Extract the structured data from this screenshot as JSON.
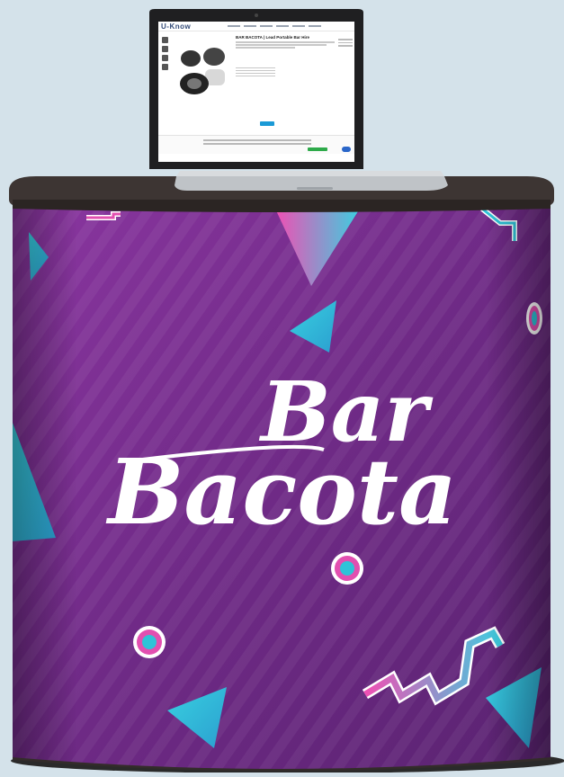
{
  "screen": {
    "brand": "U-Know",
    "product_title": "BAR BACOTA | Lead Portable Bar Hire"
  },
  "booth": {
    "headline_line1": "Bar",
    "headline_line2": "Bacota"
  },
  "colors": {
    "background": "#d4e2ea",
    "booth_purple": "#7b2f8e",
    "accent_cyan": "#2ec3d8",
    "accent_pink": "#e24fb0",
    "countertop": "#3d3533"
  },
  "icons": [
    "laptop-icon",
    "triangle-decor-icon",
    "circle-decor-icon",
    "zigzag-decor-icon",
    "corner-decor-icon"
  ]
}
